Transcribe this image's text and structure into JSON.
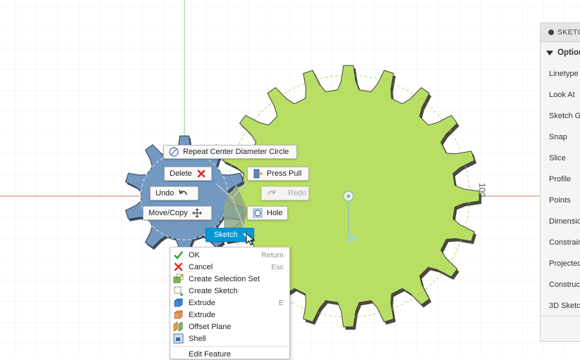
{
  "marking_menu": {
    "repeat": "Repeat Center Diameter Circle",
    "delete": "Delete",
    "press_pull": "Press Pull",
    "undo": "Undo",
    "redo": "Redo",
    "move_copy": "Move/Copy",
    "hole": "Hole",
    "sketch": "Sketch"
  },
  "context_menu": {
    "items": [
      {
        "label": "OK",
        "shortcut": "Return",
        "icon": "check-icon"
      },
      {
        "label": "Cancel",
        "shortcut": "Esc",
        "icon": "cancel-x-icon"
      },
      {
        "label": "Create Selection Set",
        "shortcut": "",
        "icon": "selection-set-icon"
      },
      {
        "label": "Create Sketch",
        "shortcut": "",
        "icon": "create-sketch-icon"
      },
      {
        "label": "Extrude",
        "shortcut": "E",
        "icon": "extrude-icon"
      },
      {
        "label": "Extrude",
        "shortcut": "",
        "icon": "extrude-orange-icon"
      },
      {
        "label": "Offset Plane",
        "shortcut": "",
        "icon": "offset-plane-icon"
      },
      {
        "label": "Shell",
        "shortcut": "",
        "icon": "shell-icon"
      },
      {
        "label": "Edit Feature",
        "shortcut": "",
        "icon": ""
      }
    ]
  },
  "palette": {
    "title": "SKETC",
    "options": "Option",
    "rows": [
      "Linetype",
      "Look At",
      "Sketch G",
      "Snap",
      "Slice",
      "Profile",
      "Points",
      "Dimensio",
      "Constrain",
      "Projected",
      "Construc",
      "3D Sketc"
    ]
  },
  "canvas": {
    "dimension_label": "100",
    "colors": {
      "large_gear": "#b8df63",
      "small_gear": "#7398c1",
      "x_axis": "#e08a8a",
      "y_axis": "#88d488",
      "accent": "#0696d7"
    }
  }
}
